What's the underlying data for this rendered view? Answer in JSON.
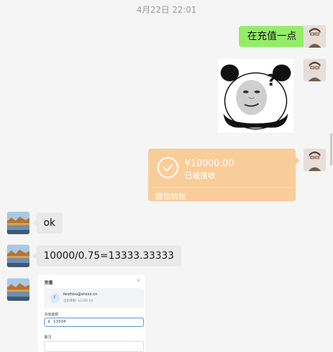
{
  "timestamp": "4月22日 22:01",
  "messages": {
    "m1_text": "在充值一点",
    "sticker_mark": "?",
    "transfer": {
      "amount": "¥10000.00",
      "status": "已被接收",
      "footer": "微信转账"
    },
    "m4_text": "ok",
    "m5_text": "10000/0.75=13333.33333"
  },
  "recharge_panel": {
    "title": "充值",
    "close": "×",
    "account_initial": "F",
    "email": "feizhou@vrxxz.cn",
    "balance": "当前余额: $1282.02",
    "amount_label": "充值金额",
    "currency": "$",
    "amount_value": "13334",
    "remark_label": "备注"
  },
  "colors": {
    "bubble_right": "#95ec69",
    "bubble_left": "#e9e9e9",
    "transfer": "#f9cd9a",
    "background": "#f5f5f5"
  }
}
